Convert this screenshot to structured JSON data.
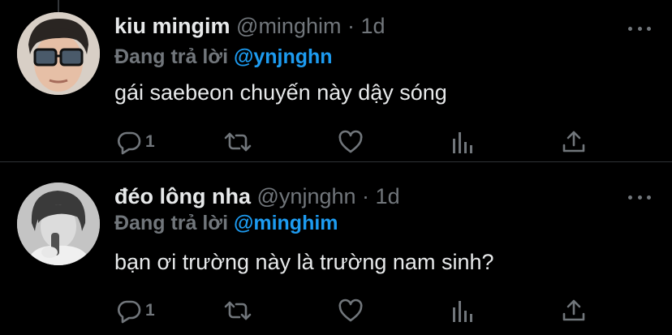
{
  "tweets": [
    {
      "name": "kiu mingim",
      "handle": "@minghim",
      "sep": "·",
      "time": "1d",
      "replying_label": "Đang trả lời",
      "replying_to": "@ynjnghn",
      "text": "gái saebeon chuyến này dậy sóng",
      "reply_count": "1"
    },
    {
      "name": "đéo lông nha",
      "handle": "@ynjnghn",
      "sep": "·",
      "time": "1d",
      "replying_label": "Đang trả lời",
      "replying_to": "@minghim",
      "text": "bạn ơi trường này là trường nam sinh?",
      "reply_count": "1"
    }
  ],
  "colors": {
    "background": "#000000",
    "text": "#e7e9ea",
    "muted": "#71767b",
    "accent": "#1d9bf0",
    "divider": "#2f3336"
  },
  "icons": [
    "more-icon",
    "reply-icon",
    "retweet-icon",
    "like-icon",
    "analytics-icon",
    "share-icon"
  ]
}
